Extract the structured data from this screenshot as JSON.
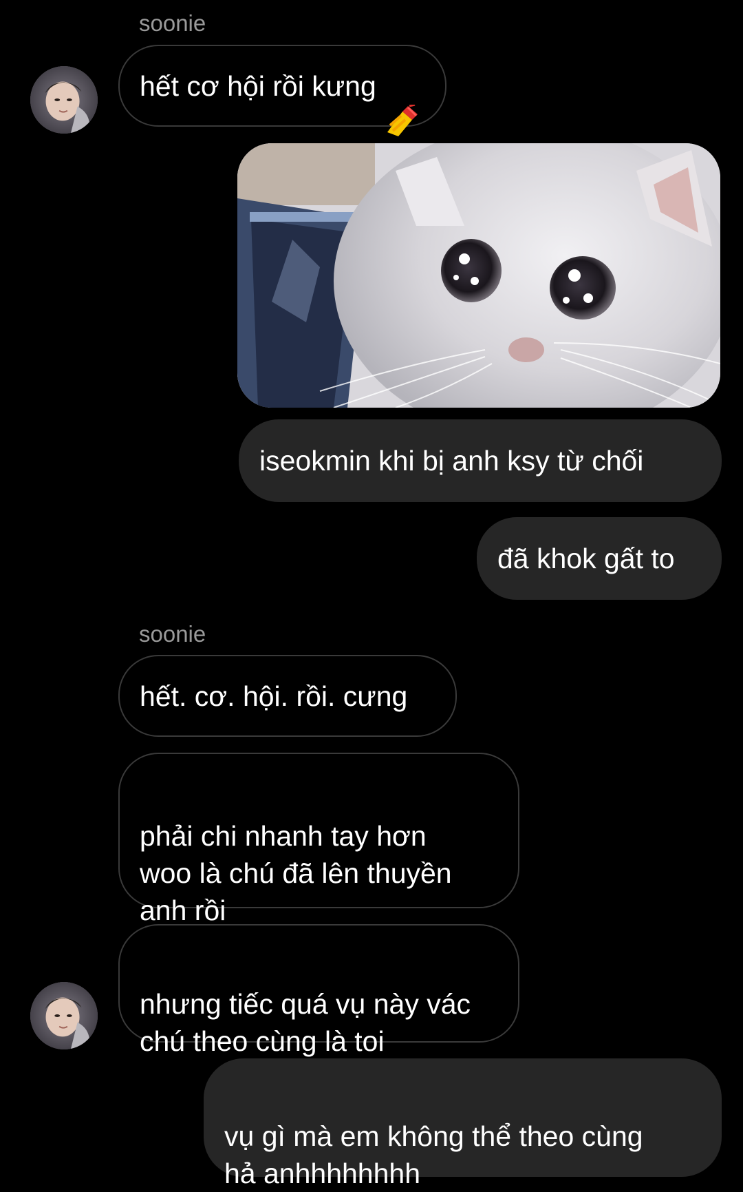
{
  "conversation": {
    "messages": [
      {
        "sender": "soonie",
        "direction": "incoming",
        "text": "hết cơ hội rồi kưng",
        "sticker": "nail-polish-emoji"
      },
      {
        "direction": "outgoing",
        "type": "image",
        "image": "crying-cat-photo"
      },
      {
        "direction": "outgoing",
        "text": "iseokmin khi bị anh ksy từ chối"
      },
      {
        "direction": "outgoing",
        "text": "đã khok gất to"
      },
      {
        "sender": "soonie",
        "direction": "incoming",
        "text": "hết. cơ. hội. rồi. cưng"
      },
      {
        "direction": "incoming",
        "text": "phải chi nhanh tay hơn\nwoo là chú đã lên thuyền\nanh rồi"
      },
      {
        "direction": "incoming",
        "text": "nhưng tiếc quá vụ này vác\nchú theo cùng là toi"
      },
      {
        "direction": "outgoing",
        "text": "vụ gì mà em không thể theo cùng\nhả anhhhhhhhh"
      }
    ]
  },
  "colors": {
    "background": "#000000",
    "incoming_border": "#3a3a3a",
    "outgoing_bubble": "#262626",
    "sender_label": "#9a9a9a",
    "text": "#ffffff"
  }
}
